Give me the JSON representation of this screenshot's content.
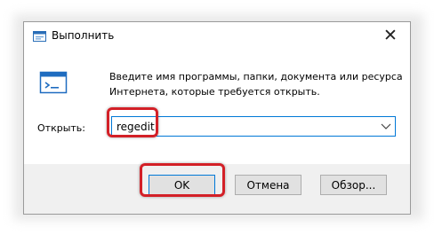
{
  "window": {
    "title": "Выполнить",
    "icon": "run-app-icon",
    "close_icon": "close-icon"
  },
  "description": {
    "line1": "Введите имя программы, папки, документа или ресурса",
    "line2": "Интернета, которые требуется открыть."
  },
  "open_field": {
    "label": "Открыть:",
    "value": "regedit",
    "dropdown_icon": "chevron-down-icon"
  },
  "buttons": {
    "ok": "OK",
    "cancel": "Отмена",
    "browse": "Обзор..."
  },
  "colors": {
    "highlight": "#d32027",
    "focus_border": "#0078d7",
    "footer_bg": "#f0f0f0",
    "button_bg": "#e1e1e1"
  }
}
